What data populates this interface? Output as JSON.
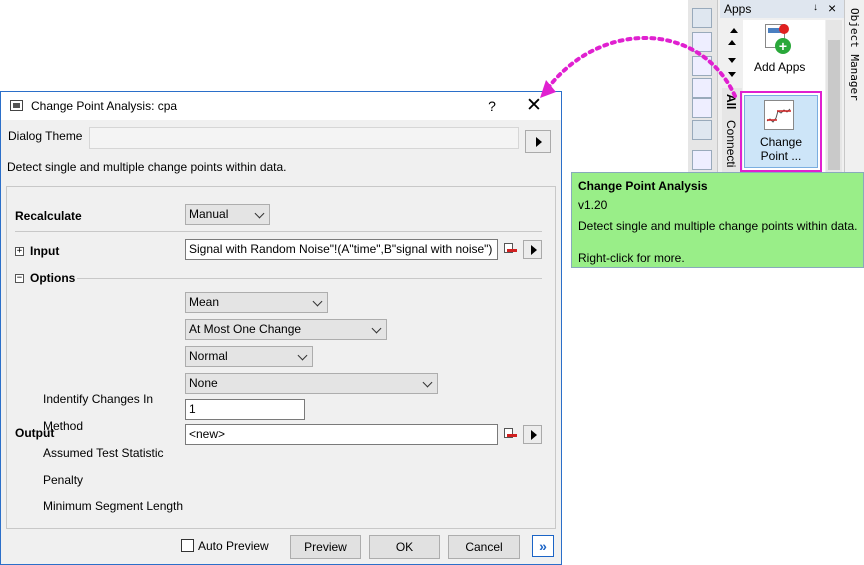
{
  "dialog": {
    "title": "Change Point Analysis: cpa",
    "help_label": "?",
    "close_label": "✕",
    "theme_label": "Dialog Theme",
    "description": "Detect single and multiple change points within data.",
    "recalculate": {
      "label": "Recalculate",
      "value": "Manual"
    },
    "input": {
      "label": "Input",
      "value": "Signal with Random Noise\"!(A\"time\",B\"signal with noise\")"
    },
    "options": {
      "label": "Options",
      "identify": {
        "label": "Indentify Changes In",
        "value": "Mean"
      },
      "method": {
        "label": "Method",
        "value": "At Most One Change"
      },
      "test_statistic": {
        "label": "Assumed Test Statistic",
        "value": "Normal"
      },
      "penalty": {
        "label": "Penalty",
        "value": "None"
      },
      "min_segment": {
        "label": "Minimum Segment Length",
        "value": "1"
      }
    },
    "output": {
      "label": "Output",
      "value": "<new>"
    },
    "buttons": {
      "auto_preview": "Auto Preview",
      "auto_preview_checked": false,
      "preview": "Preview",
      "ok": "OK",
      "cancel": "Cancel",
      "expand": "»"
    }
  },
  "apps_panel": {
    "title": "Apps",
    "pin": "↓",
    "close": "×",
    "tab_all": "All",
    "tab_connect": "Connecti",
    "add_apps_label": "Add Apps",
    "change_point_label_1": "Change",
    "change_point_label_2": "Point ...",
    "object_manager": "Object Manager"
  },
  "tooltip": {
    "title": "Change Point Analysis",
    "version": "v1.20",
    "description": "Detect single and multiple change points within data.",
    "hint": "Right-click for more."
  },
  "colors": {
    "highlight_magenta": "#e020d0",
    "tooltip_bg": "#99ee88",
    "accent_blue": "#1b64c6"
  }
}
